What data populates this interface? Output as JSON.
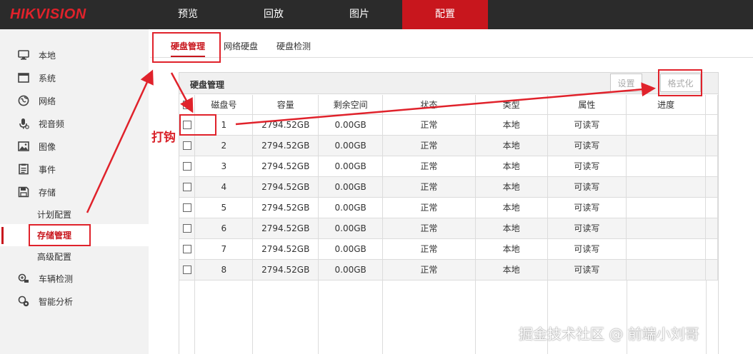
{
  "brand": {
    "logo_text": "HIKVISION",
    "logo_color": "#e0222b"
  },
  "topnav": {
    "items": [
      {
        "label": "预览",
        "active": false
      },
      {
        "label": "回放",
        "active": false
      },
      {
        "label": "图片",
        "active": false
      },
      {
        "label": "配置",
        "active": true
      }
    ],
    "active_color": "#c8161d"
  },
  "sidebar": {
    "items": [
      {
        "label": "本地",
        "icon": "monitor-icon"
      },
      {
        "label": "系统",
        "icon": "window-icon"
      },
      {
        "label": "网络",
        "icon": "globe-icon"
      },
      {
        "label": "视音频",
        "icon": "microphone-icon"
      },
      {
        "label": "图像",
        "icon": "image-icon"
      },
      {
        "label": "事件",
        "icon": "list-icon"
      },
      {
        "label": "存储",
        "icon": "floppy-icon"
      },
      {
        "label": "计划配置",
        "sub": true
      },
      {
        "label": "存储管理",
        "sub": true,
        "active": true
      },
      {
        "label": "高级配置",
        "sub": true
      },
      {
        "label": "车辆检测",
        "icon": "car-icon"
      },
      {
        "label": "智能分析",
        "icon": "analysis-icon"
      }
    ]
  },
  "tabs": [
    {
      "label": "硬盘管理",
      "active": true
    },
    {
      "label": "网络硬盘",
      "active": false
    },
    {
      "label": "硬盘检测",
      "active": false
    }
  ],
  "panel": {
    "title": "硬盘管理",
    "buttons": {
      "settings": "设置",
      "format": "格式化"
    },
    "columns": [
      "磁盘号",
      "容量",
      "剩余空间",
      "状态",
      "类型",
      "属性",
      "进度"
    ],
    "rows": [
      {
        "no": "1",
        "capacity": "2794.52GB",
        "free": "0.00GB",
        "status": "正常",
        "type": "本地",
        "attr": "可读写",
        "progress": ""
      },
      {
        "no": "2",
        "capacity": "2794.52GB",
        "free": "0.00GB",
        "status": "正常",
        "type": "本地",
        "attr": "可读写",
        "progress": ""
      },
      {
        "no": "3",
        "capacity": "2794.52GB",
        "free": "0.00GB",
        "status": "正常",
        "type": "本地",
        "attr": "可读写",
        "progress": ""
      },
      {
        "no": "4",
        "capacity": "2794.52GB",
        "free": "0.00GB",
        "status": "正常",
        "type": "本地",
        "attr": "可读写",
        "progress": ""
      },
      {
        "no": "5",
        "capacity": "2794.52GB",
        "free": "0.00GB",
        "status": "正常",
        "type": "本地",
        "attr": "可读写",
        "progress": ""
      },
      {
        "no": "6",
        "capacity": "2794.52GB",
        "free": "0.00GB",
        "status": "正常",
        "type": "本地",
        "attr": "可读写",
        "progress": ""
      },
      {
        "no": "7",
        "capacity": "2794.52GB",
        "free": "0.00GB",
        "status": "正常",
        "type": "本地",
        "attr": "可读写",
        "progress": ""
      },
      {
        "no": "8",
        "capacity": "2794.52GB",
        "free": "0.00GB",
        "status": "正常",
        "type": "本地",
        "attr": "可读写",
        "progress": ""
      }
    ]
  },
  "annotation": {
    "check_label": "打钩",
    "color": "#e0222b"
  },
  "watermark": "掘金技术社区 @ 前端小刘哥"
}
